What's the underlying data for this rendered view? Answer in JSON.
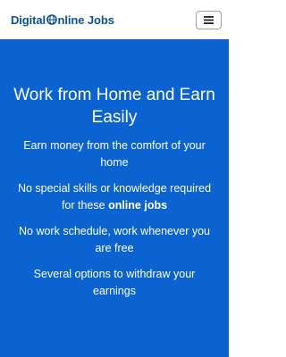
{
  "brand": {
    "name_before": "Digital",
    "name_globe_letter": "O",
    "name_after": "nline Jobs"
  },
  "hero": {
    "title": "Work from Home and Earn Easily",
    "points": [
      {
        "text": "Earn money from the comfort of your home"
      },
      {
        "text_before": "No special skills or knowledge required for these ",
        "bold": "online jobs"
      },
      {
        "text": "No work schedule, work whenever you are free"
      },
      {
        "text": "Several options to withdraw your earnings"
      }
    ]
  },
  "colors": {
    "brand": "#0d4f8f",
    "hero_background": "#0a63d1",
    "hero_text": "#ffffff"
  },
  "icons": {
    "menu": "hamburger-menu-icon",
    "logo_o": "globe-icon"
  }
}
